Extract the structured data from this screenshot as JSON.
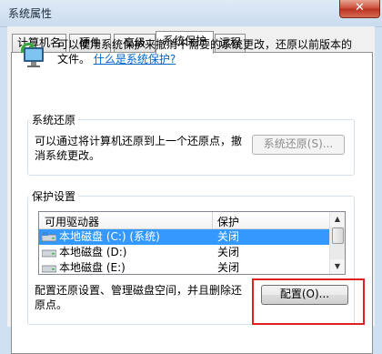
{
  "window": {
    "title": "系统属性",
    "close_label": "✕"
  },
  "tabs": [
    {
      "label": "计算机名"
    },
    {
      "label": "硬件"
    },
    {
      "label": "高级"
    },
    {
      "label": "系统保护"
    },
    {
      "label": "远程"
    }
  ],
  "intro": {
    "text": "可以使用系统保护来撤消不需要的系统更改，还原以前版本的文件。",
    "link": "什么是系统保护?"
  },
  "system_restore": {
    "group_title": "系统还原",
    "text": "可以通过将计算机还原到上一个还原点，撤消系统更改。",
    "button": "系统还原(S)..."
  },
  "protection_settings": {
    "group_title": "保护设置",
    "columns": [
      "可用驱动器",
      "保护"
    ],
    "rows": [
      {
        "name": "本地磁盘 (C:) (系统)",
        "protection": "关闭",
        "selected": true
      },
      {
        "name": "本地磁盘 (D:)",
        "protection": "关闭",
        "selected": false
      },
      {
        "name": "本地磁盘 (E:)",
        "protection": "关闭",
        "selected": false
      }
    ],
    "config_text": "配置还原设置、管理磁盘空间，并且删除还原点。",
    "config_button": "配置(O)..."
  },
  "colors": {
    "selection": "#3399ff",
    "link": "#0066cc",
    "highlight": "#e02020"
  }
}
